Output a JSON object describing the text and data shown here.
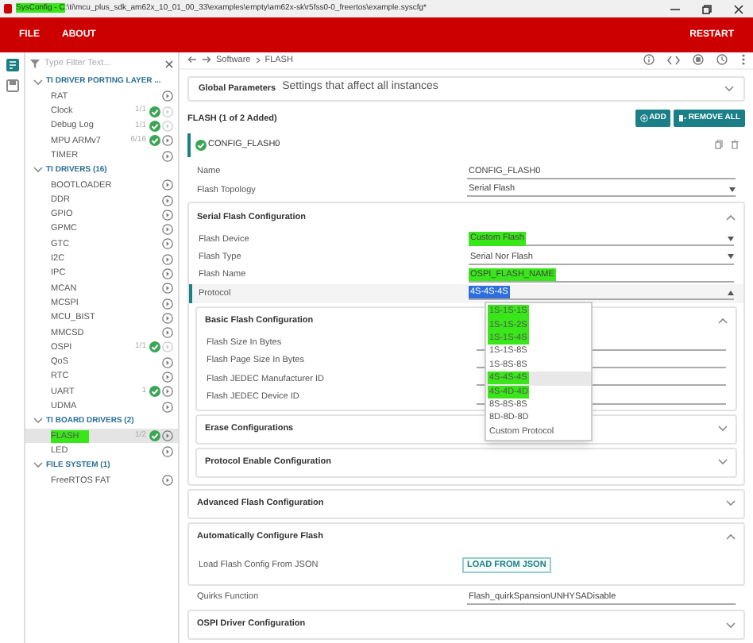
{
  "title_bar": {
    "highlighted_part": "SysConfig - C",
    "rest": ":\\ti\\mcu_plus_sdk_am62x_10_01_00_33\\examples\\empty\\am62x-sk\\r5fss0-0_freertos\\example.syscfg*"
  },
  "menu": [
    "FILE",
    "ABOUT"
  ],
  "restart": "RESTART",
  "filter": {
    "placeholder": "Type Filter Text..."
  },
  "tree": [
    {
      "label": "TI DRIVER PORTING LAYER ...",
      "expanded": true,
      "children": [
        {
          "label": "RAT",
          "checked": false,
          "add_disabled": false,
          "selected": false,
          "highlighted": false
        },
        {
          "label": "Clock",
          "count": "1/1",
          "checked": true,
          "add_disabled": true,
          "selected": false,
          "highlighted": false
        },
        {
          "label": "Debug Log",
          "count": "1/1",
          "checked": true,
          "add_disabled": true,
          "selected": false,
          "highlighted": false
        },
        {
          "label": "MPU ARMv7",
          "count": "6/16",
          "checked": true,
          "add_disabled": false,
          "selected": false,
          "highlighted": false
        },
        {
          "label": "TIMER",
          "checked": false,
          "add_disabled": false,
          "selected": false,
          "highlighted": false
        }
      ]
    },
    {
      "label": "TI DRIVERS (16)",
      "expanded": true,
      "children": [
        {
          "label": "BOOTLOADER",
          "checked": false,
          "add_disabled": false,
          "selected": false,
          "highlighted": false
        },
        {
          "label": "DDR",
          "checked": false,
          "add_disabled": false,
          "selected": false,
          "highlighted": false
        },
        {
          "label": "GPIO",
          "checked": false,
          "add_disabled": false,
          "selected": false,
          "highlighted": false
        },
        {
          "label": "GPMC",
          "checked": false,
          "add_disabled": false,
          "selected": false,
          "highlighted": false
        },
        {
          "label": "GTC",
          "checked": false,
          "add_disabled": false,
          "selected": false,
          "highlighted": false
        },
        {
          "label": "I2C",
          "checked": false,
          "add_disabled": false,
          "selected": false,
          "highlighted": false
        },
        {
          "label": "IPC",
          "checked": false,
          "add_disabled": false,
          "selected": false,
          "highlighted": false
        },
        {
          "label": "MCAN",
          "checked": false,
          "add_disabled": false,
          "selected": false,
          "highlighted": false
        },
        {
          "label": "MCSPI",
          "checked": false,
          "add_disabled": false,
          "selected": false,
          "highlighted": false
        },
        {
          "label": "MCU_BIST",
          "checked": false,
          "add_disabled": false,
          "selected": false,
          "highlighted": false
        },
        {
          "label": "MMCSD",
          "checked": false,
          "add_disabled": false,
          "selected": false,
          "highlighted": false
        },
        {
          "label": "OSPI",
          "count": "1/1",
          "checked": true,
          "add_disabled": true,
          "selected": false,
          "highlighted": false
        },
        {
          "label": "QoS",
          "checked": false,
          "add_disabled": false,
          "selected": false,
          "highlighted": false
        },
        {
          "label": "RTC",
          "checked": false,
          "add_disabled": false,
          "selected": false,
          "highlighted": false
        },
        {
          "label": "UART",
          "count": "1",
          "checked": true,
          "add_disabled": false,
          "selected": false,
          "highlighted": false
        },
        {
          "label": "UDMA",
          "checked": false,
          "add_disabled": false,
          "selected": false,
          "highlighted": false
        }
      ]
    },
    {
      "label": "TI BOARD DRIVERS (2)",
      "expanded": true,
      "children": [
        {
          "label": "FLASH",
          "count": "1/2",
          "checked": true,
          "add_disabled": false,
          "selected": true,
          "highlighted": true
        },
        {
          "label": "LED",
          "checked": false,
          "add_disabled": false,
          "selected": false,
          "highlighted": false
        }
      ]
    },
    {
      "label": "FILE SYSTEM (1)",
      "expanded": true,
      "children": [
        {
          "label": "FreeRTOS FAT",
          "checked": false,
          "add_disabled": false,
          "selected": false,
          "highlighted": false
        }
      ]
    }
  ],
  "breadcrumb": [
    "Software",
    "FLASH"
  ],
  "global_parameters": {
    "title": "Global Parameters",
    "subtitle": "Settings that affect all instances"
  },
  "module_title": "FLASH (1 of 2 Added)",
  "buttons": [
    "ADD",
    "REMOVE ALL"
  ],
  "instance": "CONFIG_FLASH0",
  "form": [
    {
      "kind": "text",
      "label": "Name",
      "value": "CONFIG_FLASH0",
      "highlighted": false,
      "focused": false
    },
    {
      "kind": "select",
      "label": "Flash Topology",
      "value": "Serial Flash",
      "highlighted": false,
      "focused": false
    },
    {
      "kind": "section",
      "title": "Serial Flash Configuration",
      "expanded": true,
      "children": [
        {
          "kind": "select",
          "label": "Flash Device",
          "value": "Custom Flash",
          "highlighted": true,
          "focused": false
        },
        {
          "kind": "select",
          "label": "Flash Type",
          "value": "Serial Nor Flash",
          "highlighted": false,
          "focused": false
        },
        {
          "kind": "text",
          "label": "Flash Name",
          "value": "OSPI_FLASH_NAME",
          "highlighted": true,
          "focused": false
        },
        {
          "kind": "select",
          "label": "Protocol",
          "value": "4S-4S-4S",
          "highlighted": false,
          "focused": true
        },
        {
          "kind": "section",
          "title": "Basic Flash Configuration",
          "expanded": true,
          "children": [
            {
              "kind": "text",
              "label": "Flash Size In Bytes",
              "focused": false
            },
            {
              "kind": "text",
              "label": "Flash Page Size In Bytes",
              "focused": false
            },
            {
              "kind": "text",
              "label": "Flash JEDEC Manufacturer ID",
              "focused": false
            },
            {
              "kind": "text",
              "label": "Flash JEDEC Device ID",
              "focused": false
            }
          ]
        },
        {
          "kind": "section",
          "title": "Erase Configurations",
          "expanded": false
        },
        {
          "kind": "section",
          "title": "Protocol Enable Configuration",
          "expanded": false
        }
      ]
    },
    {
      "kind": "section",
      "title": "Advanced Flash Configuration",
      "expanded": false
    },
    {
      "kind": "section",
      "title": "Automatically Configure Flash",
      "expanded": true,
      "children": [
        {
          "kind": "button_row",
          "label": "Load Flash Config From JSON",
          "button": "LOAD FROM JSON"
        }
      ]
    },
    {
      "kind": "text",
      "label": "Quirks Function",
      "value": "Flash_quirkSpansionUNHYSADisable",
      "highlighted": false,
      "focused": false
    },
    {
      "kind": "section",
      "title": "OSPI Driver Configuration",
      "expanded": false
    }
  ],
  "protocol_options": [
    {
      "label": "1S-1S-1S",
      "selected": false,
      "highlighted": true
    },
    {
      "label": "1S-1S-2S",
      "selected": false,
      "highlighted": true
    },
    {
      "label": "1S-1S-4S",
      "selected": false,
      "highlighted": true
    },
    {
      "label": "1S-1S-8S",
      "selected": false,
      "highlighted": false
    },
    {
      "label": "1S-8S-8S",
      "selected": false,
      "highlighted": false
    },
    {
      "label": "4S-4S-4S",
      "selected": true,
      "highlighted": true
    },
    {
      "label": "4S-4D-4D",
      "selected": false,
      "highlighted": true
    },
    {
      "label": "8S-8S-8S",
      "selected": false,
      "highlighted": false
    },
    {
      "label": "8D-8D-8D",
      "selected": false,
      "highlighted": false
    },
    {
      "label": "Custom Protocol",
      "selected": false,
      "highlighted": false
    }
  ]
}
